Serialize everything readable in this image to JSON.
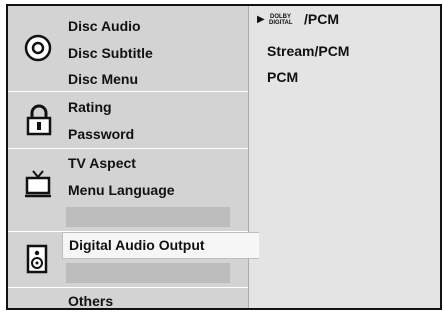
{
  "menu": {
    "groups": [
      {
        "icon": "disc-icon",
        "items": [
          "Disc Audio",
          "Disc Subtitle",
          "Disc Menu"
        ]
      },
      {
        "icon": "lock-icon",
        "items": [
          "Rating",
          "Password"
        ]
      },
      {
        "icon": "tv-icon",
        "items": [
          "TV Aspect",
          "Menu Language"
        ]
      },
      {
        "icon": "speaker-icon",
        "items": [
          "Digital Audio Output"
        ]
      },
      {
        "icon": "",
        "items": [
          "Others"
        ]
      }
    ],
    "selected": "Digital Audio Output"
  },
  "options": {
    "items": [
      "DOLBY DIGITAL /PCM",
      "Stream/PCM",
      "PCM"
    ],
    "dolby_logo_lines": [
      "DOLBY",
      "DIGITAL"
    ],
    "first_suffix": "/PCM",
    "current": "DOLBY DIGITAL /PCM",
    "marker": "▶"
  }
}
